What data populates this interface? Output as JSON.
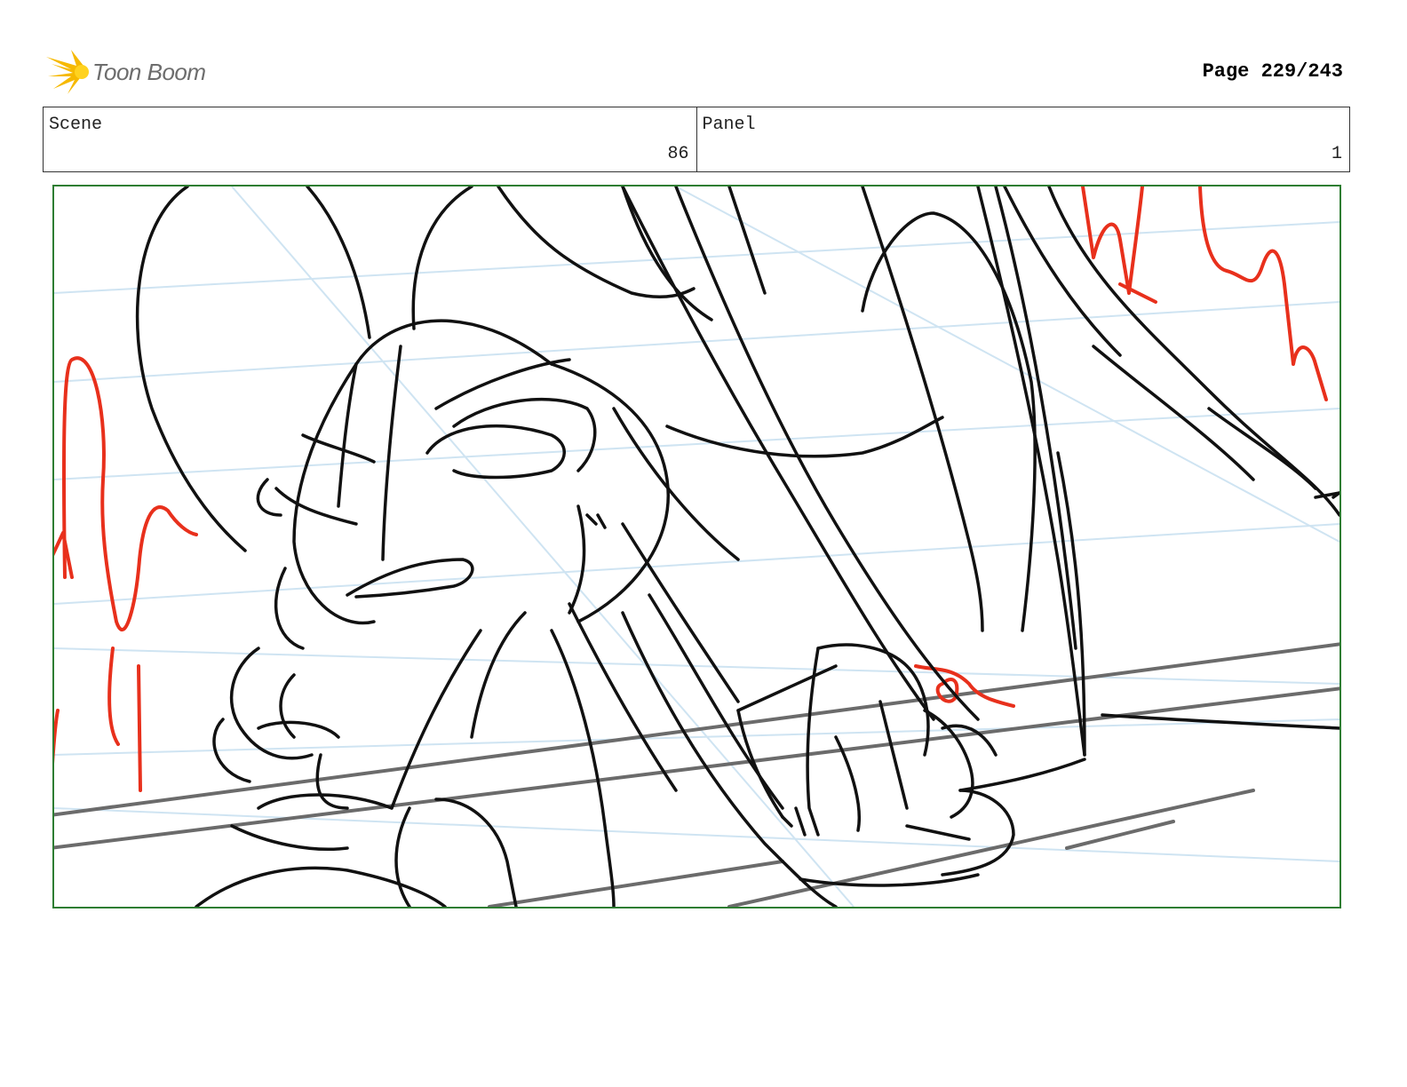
{
  "header": {
    "logo_text": "Toon Boom",
    "page_label": "Page 229/243"
  },
  "info": {
    "scene_label": "Scene",
    "scene_value": "86",
    "panel_label": "Panel",
    "panel_value": "1"
  },
  "colors": {
    "frame": "#2e7d32",
    "sketch": "#111111",
    "accent_red": "#e8301c",
    "guide_blue": "#cfe4f2",
    "gray_line": "#6b6b6b"
  }
}
